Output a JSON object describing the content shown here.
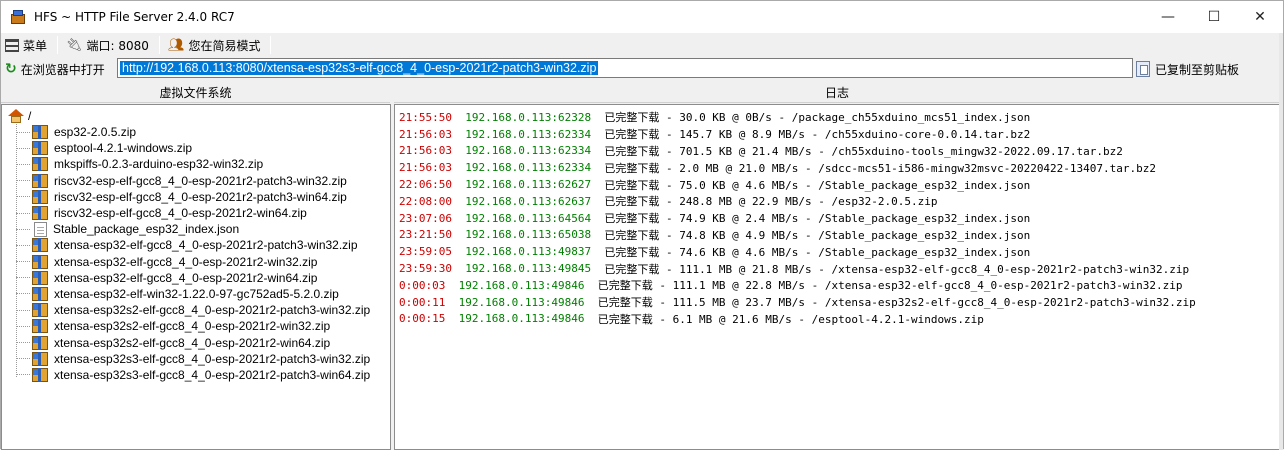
{
  "window": {
    "title": "HFS ~ HTTP File Server 2.4.0 RC7",
    "minimize": "—",
    "maximize": "☐",
    "close": "✕"
  },
  "toolbar": {
    "menu_label": "菜单",
    "port_label": "端口: 8080",
    "mode_label": "您在简易模式",
    "open_in_browser_label": "在浏览器中打开",
    "url": "http://192.168.0.113:8080/xtensa-esp32s3-elf-gcc8_4_0-esp-2021r2-patch3-win32.zip",
    "copied_label": "已复制至剪贴板"
  },
  "left_panel": {
    "title": "虚拟文件系统",
    "root": "/",
    "files": [
      {
        "name": "esp32-2.0.5.zip",
        "icon": "zip-icon"
      },
      {
        "name": "esptool-4.2.1-windows.zip",
        "icon": "zip-icon"
      },
      {
        "name": "mkspiffs-0.2.3-arduino-esp32-win32.zip",
        "icon": "zip-icon"
      },
      {
        "name": "riscv32-esp-elf-gcc8_4_0-esp-2021r2-patch3-win32.zip",
        "icon": "zip-icon"
      },
      {
        "name": "riscv32-esp-elf-gcc8_4_0-esp-2021r2-patch3-win64.zip",
        "icon": "zip-icon"
      },
      {
        "name": "riscv32-esp-elf-gcc8_4_0-esp-2021r2-win64.zip",
        "icon": "zip-icon"
      },
      {
        "name": "Stable_package_esp32_index.json",
        "icon": "document-icon"
      },
      {
        "name": "xtensa-esp32-elf-gcc8_4_0-esp-2021r2-patch3-win32.zip",
        "icon": "zip-icon"
      },
      {
        "name": "xtensa-esp32-elf-gcc8_4_0-esp-2021r2-win32.zip",
        "icon": "zip-icon"
      },
      {
        "name": "xtensa-esp32-elf-gcc8_4_0-esp-2021r2-win64.zip",
        "icon": "zip-icon"
      },
      {
        "name": "xtensa-esp32-elf-win32-1.22.0-97-gc752ad5-5.2.0.zip",
        "icon": "zip-icon"
      },
      {
        "name": "xtensa-esp32s2-elf-gcc8_4_0-esp-2021r2-patch3-win32.zip",
        "icon": "zip-icon"
      },
      {
        "name": "xtensa-esp32s2-elf-gcc8_4_0-esp-2021r2-win32.zip",
        "icon": "zip-icon"
      },
      {
        "name": "xtensa-esp32s2-elf-gcc8_4_0-esp-2021r2-win64.zip",
        "icon": "zip-icon"
      },
      {
        "name": "xtensa-esp32s3-elf-gcc8_4_0-esp-2021r2-patch3-win32.zip",
        "icon": "zip-icon"
      },
      {
        "name": "xtensa-esp32s3-elf-gcc8_4_0-esp-2021r2-patch3-win64.zip",
        "icon": "zip-icon"
      }
    ]
  },
  "right_panel": {
    "title": "日志",
    "entries": [
      {
        "time": "21:55:50",
        "ip": "192.168.0.113:62328",
        "msg": "已完整下载 - 30.0 KB @ 0B/s - /package_ch55xduino_mcs51_index.json"
      },
      {
        "time": "21:56:03",
        "ip": "192.168.0.113:62334",
        "msg": "已完整下载 - 145.7 KB @ 8.9 MB/s - /ch55xduino-core-0.0.14.tar.bz2"
      },
      {
        "time": "21:56:03",
        "ip": "192.168.0.113:62334",
        "msg": "已完整下载 - 701.5 KB @ 21.4 MB/s - /ch55xduino-tools_mingw32-2022.09.17.tar.bz2"
      },
      {
        "time": "21:56:03",
        "ip": "192.168.0.113:62334",
        "msg": "已完整下载 - 2.0 MB @ 21.0 MB/s - /sdcc-mcs51-i586-mingw32msvc-20220422-13407.tar.bz2"
      },
      {
        "time": "22:06:50",
        "ip": "192.168.0.113:62627",
        "msg": "已完整下载 - 75.0 KB @ 4.6 MB/s - /Stable_package_esp32_index.json"
      },
      {
        "time": "22:08:00",
        "ip": "192.168.0.113:62637",
        "msg": "已完整下载 - 248.8 MB @ 22.9 MB/s - /esp32-2.0.5.zip"
      },
      {
        "time": "23:07:06",
        "ip": "192.168.0.113:64564",
        "msg": "已完整下载 - 74.9 KB @ 2.4 MB/s - /Stable_package_esp32_index.json"
      },
      {
        "time": "23:21:50",
        "ip": "192.168.0.113:65038",
        "msg": "已完整下载 - 74.8 KB @ 4.9 MB/s - /Stable_package_esp32_index.json"
      },
      {
        "time": "23:59:05",
        "ip": "192.168.0.113:49837",
        "msg": "已完整下载 - 74.6 KB @ 4.6 MB/s - /Stable_package_esp32_index.json"
      },
      {
        "time": "23:59:30",
        "ip": "192.168.0.113:49845",
        "msg": "已完整下载 - 111.1 MB @ 21.8 MB/s - /xtensa-esp32-elf-gcc8_4_0-esp-2021r2-patch3-win32.zip"
      },
      {
        "time": "0:00:03",
        "ip": "192.168.0.113:49846",
        "msg": "已完整下载 - 111.1 MB @ 22.8 MB/s - /xtensa-esp32-elf-gcc8_4_0-esp-2021r2-patch3-win32.zip"
      },
      {
        "time": "0:00:11",
        "ip": "192.168.0.113:49846",
        "msg": "已完整下载 - 111.5 MB @ 23.7 MB/s - /xtensa-esp32s2-elf-gcc8_4_0-esp-2021r2-patch3-win32.zip"
      },
      {
        "time": "0:00:15",
        "ip": "192.168.0.113:49846",
        "msg": "已完整下载 - 6.1 MB @ 21.6 MB/s - /esptool-4.2.1-windows.zip"
      }
    ]
  },
  "colors": {
    "log_time": "#cc0000",
    "log_ip": "#008000",
    "url_selection": "#0078d7"
  }
}
